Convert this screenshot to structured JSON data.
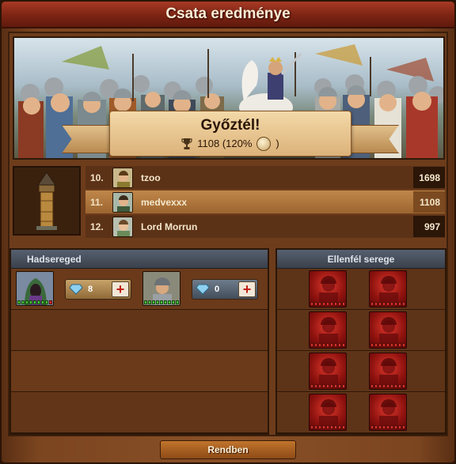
{
  "window": {
    "title": "Csata eredménye"
  },
  "result": {
    "headline": "Győztél!",
    "score": "1108 (120%",
    "score_suffix": ")"
  },
  "ranking": [
    {
      "rank": "10.",
      "name": "tzoo",
      "score": "1698",
      "active": false
    },
    {
      "rank": "11.",
      "name": "medvexxx",
      "score": "1108",
      "active": true
    },
    {
      "rank": "12.",
      "name": "Lord Morrun",
      "score": "997",
      "active": false
    }
  ],
  "own_army": {
    "title": "Hadsereged",
    "units": [
      {
        "icon": "hooded-rogue-unit-icon",
        "boost": "8"
      },
      {
        "icon": "armored-soldier-unit-icon",
        "boost": "0"
      }
    ]
  },
  "enemy_army": {
    "title": "Ellenfél serege",
    "units": [
      "defeated-soldier-icon",
      "defeated-soldier-icon",
      "defeated-soldier-icon",
      "defeated-soldier-icon",
      "defeated-soldier-icon",
      "defeated-soldier-icon",
      "defeated-soldier-icon",
      "defeated-soldier-icon"
    ]
  },
  "buttons": {
    "ok": "Rendben"
  },
  "colors": {
    "title_bar": "#7c2413",
    "active_row": "#b07840",
    "enemy_unit": "#c0281e",
    "health": "#48c23a"
  }
}
